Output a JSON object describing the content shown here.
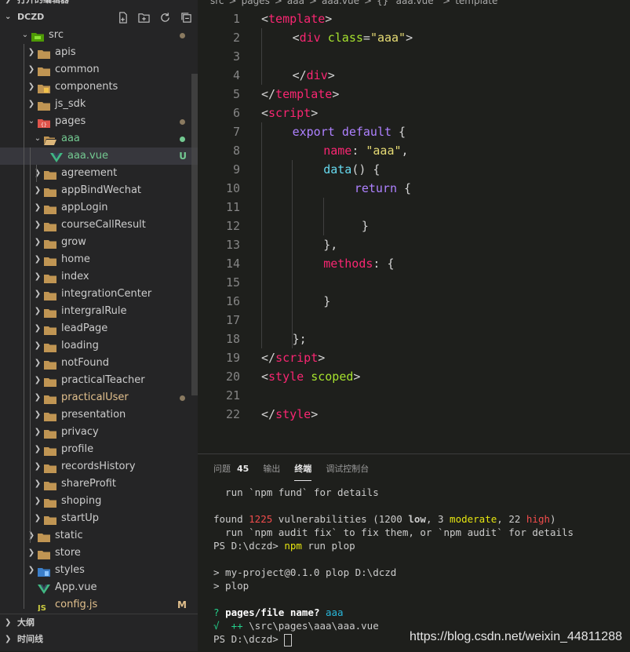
{
  "sidebar": {
    "open_editors_label": "打开的编辑器",
    "project_label": "DCZD",
    "tree": [
      {
        "label": "src",
        "kind": "folder-src",
        "open": true,
        "depth": 1,
        "status": "dot"
      },
      {
        "label": "apis",
        "kind": "folder",
        "open": false,
        "depth": 2
      },
      {
        "label": "common",
        "kind": "folder",
        "open": false,
        "depth": 2
      },
      {
        "label": "components",
        "kind": "folder-components",
        "open": false,
        "depth": 2
      },
      {
        "label": "js_sdk",
        "kind": "folder",
        "open": false,
        "depth": 2
      },
      {
        "label": "pages",
        "kind": "folder-pages",
        "open": true,
        "depth": 2,
        "status": "dot"
      },
      {
        "label": "aaa",
        "kind": "folder-open",
        "open": true,
        "depth": 3,
        "status": "dot-green",
        "untracked": true
      },
      {
        "label": "aaa.vue",
        "kind": "vue",
        "depth": 4,
        "badge": "U",
        "untracked": true,
        "selected": true
      },
      {
        "label": "agreement",
        "kind": "folder",
        "open": false,
        "depth": 3
      },
      {
        "label": "appBindWechat",
        "kind": "folder",
        "open": false,
        "depth": 3
      },
      {
        "label": "appLogin",
        "kind": "folder",
        "open": false,
        "depth": 3
      },
      {
        "label": "courseCallResult",
        "kind": "folder",
        "open": false,
        "depth": 3
      },
      {
        "label": "grow",
        "kind": "folder",
        "open": false,
        "depth": 3
      },
      {
        "label": "home",
        "kind": "folder",
        "open": false,
        "depth": 3
      },
      {
        "label": "index",
        "kind": "folder",
        "open": false,
        "depth": 3
      },
      {
        "label": "integrationCenter",
        "kind": "folder",
        "open": false,
        "depth": 3
      },
      {
        "label": "intergralRule",
        "kind": "folder",
        "open": false,
        "depth": 3
      },
      {
        "label": "leadPage",
        "kind": "folder",
        "open": false,
        "depth": 3
      },
      {
        "label": "loading",
        "kind": "folder",
        "open": false,
        "depth": 3
      },
      {
        "label": "notFound",
        "kind": "folder",
        "open": false,
        "depth": 3
      },
      {
        "label": "practicalTeacher",
        "kind": "folder",
        "open": false,
        "depth": 3
      },
      {
        "label": "practicalUser",
        "kind": "folder",
        "open": false,
        "depth": 3,
        "status": "dot",
        "modified": true
      },
      {
        "label": "presentation",
        "kind": "folder",
        "open": false,
        "depth": 3
      },
      {
        "label": "privacy",
        "kind": "folder",
        "open": false,
        "depth": 3
      },
      {
        "label": "profile",
        "kind": "folder",
        "open": false,
        "depth": 3
      },
      {
        "label": "recordsHistory",
        "kind": "folder",
        "open": false,
        "depth": 3
      },
      {
        "label": "shareProfit",
        "kind": "folder",
        "open": false,
        "depth": 3
      },
      {
        "label": "shoping",
        "kind": "folder",
        "open": false,
        "depth": 3
      },
      {
        "label": "startUp",
        "kind": "folder",
        "open": false,
        "depth": 3
      },
      {
        "label": "static",
        "kind": "folder",
        "open": false,
        "depth": 2
      },
      {
        "label": "store",
        "kind": "folder",
        "open": false,
        "depth": 2
      },
      {
        "label": "styles",
        "kind": "folder-styles",
        "open": false,
        "depth": 2
      },
      {
        "label": "App.vue",
        "kind": "vue",
        "depth": 2
      },
      {
        "label": "config.js",
        "kind": "js",
        "depth": 2,
        "badge": "M",
        "modified": true
      }
    ],
    "outline_label": "大纲",
    "timeline_label": "时间线"
  },
  "breadcrumb": [
    "src",
    ">",
    "pages",
    ">",
    "aaa",
    ">",
    "aaa.vue",
    ">",
    "{} \"aaa.vue\"",
    ">",
    "template"
  ],
  "editor": {
    "lines": [
      {
        "n": "1",
        "indent": 0,
        "tokens": [
          [
            "punc",
            "<"
          ],
          [
            "tag",
            "template"
          ],
          [
            "punc",
            ">"
          ]
        ]
      },
      {
        "n": "2",
        "indent": 1,
        "tokens": [
          [
            "punc",
            "<"
          ],
          [
            "tag",
            "div"
          ],
          [
            "punc",
            " "
          ],
          [
            "attr",
            "class"
          ],
          [
            "punc",
            "="
          ],
          [
            "str",
            "\"aaa\""
          ],
          [
            "punc",
            ">"
          ]
        ]
      },
      {
        "n": "3",
        "indent": 0,
        "tokens": []
      },
      {
        "n": "4",
        "indent": 1,
        "tokens": [
          [
            "punc",
            "</"
          ],
          [
            "tag",
            "div"
          ],
          [
            "punc",
            ">"
          ]
        ]
      },
      {
        "n": "5",
        "indent": 0,
        "tokens": [
          [
            "punc",
            "</"
          ],
          [
            "tag",
            "template"
          ],
          [
            "punc",
            ">"
          ]
        ]
      },
      {
        "n": "6",
        "indent": 0,
        "tokens": [
          [
            "punc",
            "<"
          ],
          [
            "tag",
            "script"
          ],
          [
            "punc",
            ">"
          ]
        ]
      },
      {
        "n": "7",
        "indent": 1,
        "tokens": [
          [
            "kw",
            "export"
          ],
          [
            "punc",
            " "
          ],
          [
            "kw",
            "default"
          ],
          [
            "punc",
            " {"
          ]
        ]
      },
      {
        "n": "8",
        "indent": 2,
        "tokens": [
          [
            "prop",
            "name"
          ],
          [
            "punc",
            ": "
          ],
          [
            "str",
            "\"aaa\""
          ],
          [
            "punc",
            ","
          ]
        ]
      },
      {
        "n": "9",
        "indent": 2,
        "tokens": [
          [
            "fn",
            "data"
          ],
          [
            "punc",
            "() {"
          ]
        ]
      },
      {
        "n": "10",
        "indent": 3,
        "tokens": [
          [
            "kw",
            "return"
          ],
          [
            "punc",
            " {"
          ]
        ]
      },
      {
        "n": "11",
        "indent": 0,
        "tokens": []
      },
      {
        "n": "12",
        "indent": 3,
        "tokens": [
          [
            "punc",
            " }"
          ]
        ]
      },
      {
        "n": "13",
        "indent": 2,
        "tokens": [
          [
            "punc",
            "},"
          ]
        ]
      },
      {
        "n": "14",
        "indent": 2,
        "tokens": [
          [
            "prop",
            "methods"
          ],
          [
            "punc",
            ": {"
          ]
        ]
      },
      {
        "n": "15",
        "indent": 0,
        "tokens": []
      },
      {
        "n": "16",
        "indent": 2,
        "tokens": [
          [
            "punc",
            "}"
          ]
        ]
      },
      {
        "n": "17",
        "indent": 0,
        "tokens": []
      },
      {
        "n": "18",
        "indent": 1,
        "tokens": [
          [
            "punc",
            "};"
          ]
        ]
      },
      {
        "n": "19",
        "indent": 0,
        "tokens": [
          [
            "punc",
            "</"
          ],
          [
            "tag",
            "script"
          ],
          [
            "punc",
            ">"
          ]
        ]
      },
      {
        "n": "20",
        "indent": 0,
        "tokens": [
          [
            "punc",
            "<"
          ],
          [
            "tag",
            "style"
          ],
          [
            "punc",
            " "
          ],
          [
            "attr",
            "scoped"
          ],
          [
            "punc",
            ">"
          ]
        ]
      },
      {
        "n": "21",
        "indent": 0,
        "tokens": []
      },
      {
        "n": "22",
        "indent": 0,
        "tokens": [
          [
            "punc",
            "</"
          ],
          [
            "tag",
            "style"
          ],
          [
            "punc",
            ">"
          ]
        ]
      }
    ]
  },
  "panel": {
    "tabs": [
      {
        "label": "问题",
        "count": "45"
      },
      {
        "label": "输出"
      },
      {
        "label": "终端",
        "active": true
      },
      {
        "label": "调试控制台"
      }
    ],
    "terminal": [
      [
        [
          "n",
          "  run `npm fund` for details"
        ]
      ],
      [],
      [
        [
          "n",
          "found "
        ],
        [
          "red",
          "1225"
        ],
        [
          "n",
          " vulnerabilities (1200 "
        ],
        [
          "bold",
          "low"
        ],
        [
          "n",
          ", 3 "
        ],
        [
          "yellow",
          "moderate"
        ],
        [
          "n",
          ", 22 "
        ],
        [
          "red",
          "high"
        ],
        [
          "n",
          ")"
        ]
      ],
      [
        [
          "n",
          "  run `npm audit fix` to fix them, or `npm audit` for details"
        ]
      ],
      [
        [
          "n",
          "PS D:\\dczd> "
        ],
        [
          "yellow",
          "npm"
        ],
        [
          "n",
          " run plop"
        ]
      ],
      [],
      [
        [
          "n",
          "> my-project@0.1.0 plop D:\\dczd"
        ]
      ],
      [
        [
          "n",
          "> plop"
        ]
      ],
      [],
      [
        [
          "green",
          "? "
        ],
        [
          "white",
          "pages/file name? "
        ],
        [
          "cyan",
          "aaa"
        ]
      ],
      [
        [
          "green",
          "√  ++ "
        ],
        [
          "n",
          "\\src\\pages\\aaa\\aaa.vue"
        ]
      ],
      [
        [
          "n",
          "PS D:\\dczd> "
        ],
        [
          "cursor",
          ""
        ]
      ]
    ]
  },
  "watermark": "https://blog.csdn.net/weixin_44811288"
}
